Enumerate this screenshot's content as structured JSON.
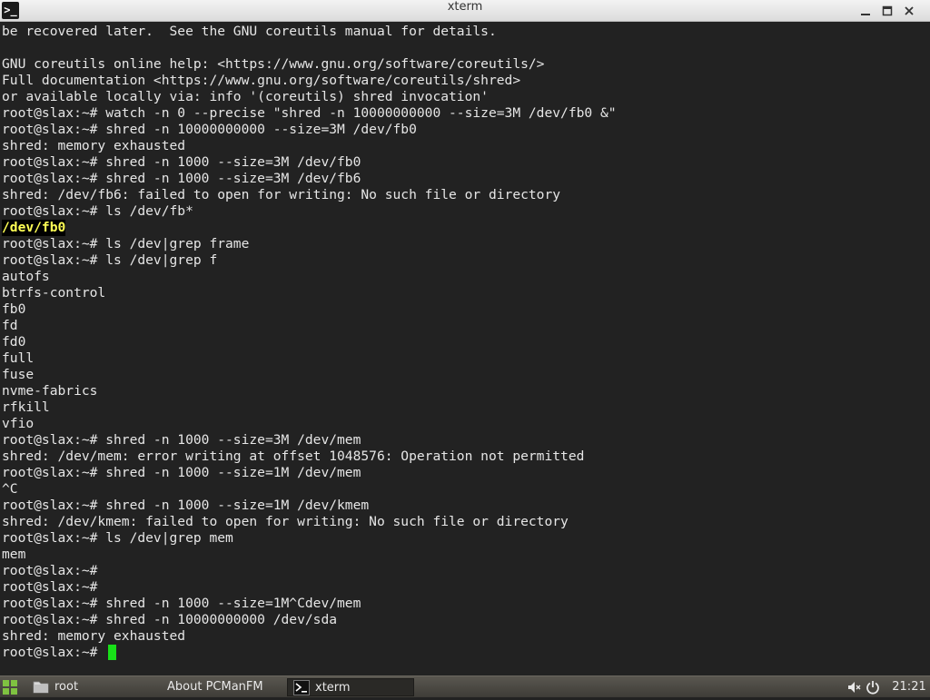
{
  "window": {
    "title": "xterm",
    "app_icon_glyph": ">_"
  },
  "terminal": {
    "lines": [
      "be recovered later.  See the GNU coreutils manual for details.",
      "",
      "GNU coreutils online help: <https://www.gnu.org/software/coreutils/>",
      "Full documentation <https://www.gnu.org/software/coreutils/shred>",
      "or available locally via: info '(coreutils) shred invocation'",
      "root@slax:~# watch -n 0 --precise \"shred -n 10000000000 --size=3M /dev/fb0 &\"",
      "root@slax:~# shred -n 10000000000 --size=3M /dev/fb0",
      "shred: memory exhausted",
      "root@slax:~# shred -n 1000 --size=3M /dev/fb0",
      "root@slax:~# shred -n 1000 --size=3M /dev/fb6",
      "shred: /dev/fb6: failed to open for writing: No such file or directory",
      "root@slax:~# ls /dev/fb*",
      "/dev/fb0",
      "root@slax:~# ls /dev|grep frame",
      "root@slax:~# ls /dev|grep f",
      "autofs",
      "btrfs-control",
      "fb0",
      "fd",
      "fd0",
      "full",
      "fuse",
      "nvme-fabrics",
      "rfkill",
      "vfio",
      "root@slax:~# shred -n 1000 --size=3M /dev/mem",
      "shred: /dev/mem: error writing at offset 1048576: Operation not permitted",
      "root@slax:~# shred -n 1000 --size=1M /dev/mem",
      "^C",
      "root@slax:~# shred -n 1000 --size=1M /dev/kmem",
      "shred: /dev/kmem: failed to open for writing: No such file or directory",
      "root@slax:~# ls /dev|grep mem",
      "mem",
      "root@slax:~#",
      "root@slax:~#",
      "root@slax:~# shred -n 1000 --size=1M^Cdev/mem",
      "root@slax:~# shred -n 10000000000 /dev/sda",
      "shred: memory exhausted",
      "root@slax:~# "
    ],
    "highlight_line_index": 12,
    "text_color": "#e6e6e6",
    "background_color": "#222222",
    "highlight_color": "#ffff55",
    "cursor_color": "#18e018"
  },
  "taskbar": {
    "start_icon": "grid-menu-icon",
    "tasks": [
      {
        "label": "root",
        "icon": "folder-icon",
        "active": false
      },
      {
        "label": "About PCManFM",
        "icon": "",
        "active": false
      },
      {
        "label": "xterm",
        "icon": "terminal-icon",
        "active": true
      }
    ],
    "tray": {
      "volume_icon": "volume-muted-icon",
      "power_icon": "power-icon",
      "clock": "21:21"
    }
  }
}
